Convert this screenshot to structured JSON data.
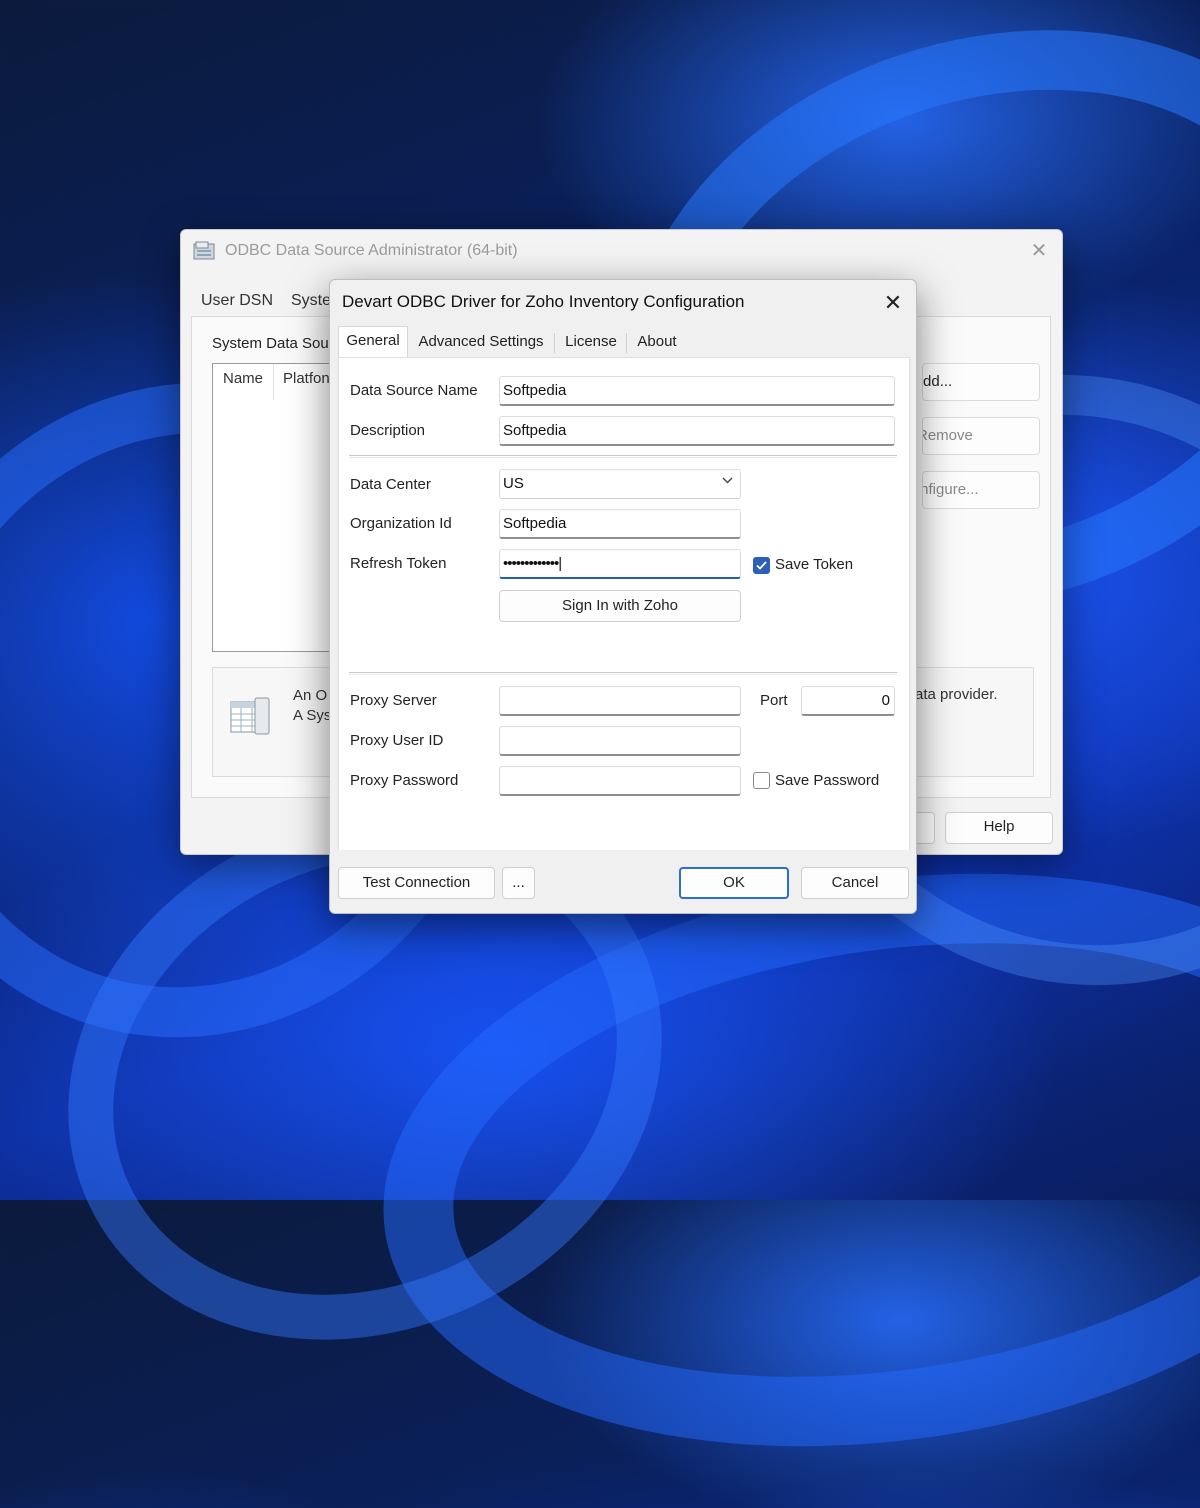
{
  "back_window": {
    "title": "ODBC Data Source Administrator (64-bit)",
    "close_glyph": "✕",
    "tabs": [
      "User DSN",
      "Syste"
    ],
    "panel_label": "System Data Sou",
    "columns": [
      "Name",
      "Platfon"
    ],
    "buttons": [
      "Add...",
      "Remove",
      "Configure..."
    ],
    "info_text_line1": "An O",
    "info_text_line2": "A Sys",
    "info_text_right": "ata provider.",
    "help_label": "Help"
  },
  "dialog": {
    "title": "Devart ODBC Driver for Zoho Inventory Configuration",
    "close_glyph": "✕",
    "tabs": [
      "General",
      "Advanced Settings",
      "License",
      "About"
    ],
    "active_tab": "General",
    "fields": {
      "data_source_name": {
        "label": "Data Source Name",
        "value": "Softpedia"
      },
      "description": {
        "label": "Description",
        "value": "Softpedia"
      },
      "data_center": {
        "label": "Data Center",
        "value": "US"
      },
      "organization_id": {
        "label": "Organization Id",
        "value": "Softpedia"
      },
      "refresh_token": {
        "label": "Refresh Token",
        "value": "•••••••••••••|"
      },
      "proxy_server": {
        "label": "Proxy Server",
        "value": ""
      },
      "port": {
        "label": "Port",
        "value": "0"
      },
      "proxy_user_id": {
        "label": "Proxy User ID",
        "value": ""
      },
      "proxy_password": {
        "label": "Proxy Password",
        "value": ""
      }
    },
    "save_token": {
      "label": "Save Token",
      "checked": true
    },
    "save_password": {
      "label": "Save Password",
      "checked": false
    },
    "sign_in_label": "Sign In with Zoho",
    "footer": {
      "test_connection": "Test Connection",
      "more": "...",
      "ok": "OK",
      "cancel": "Cancel"
    }
  },
  "colors": {
    "accent": "#2b5fb8",
    "default_button_border": "#2b6fd1"
  },
  "icons": [
    "odbc-app-icon",
    "data-source-icon",
    "chevron-down-icon",
    "close-icon",
    "checkmark-icon"
  ]
}
